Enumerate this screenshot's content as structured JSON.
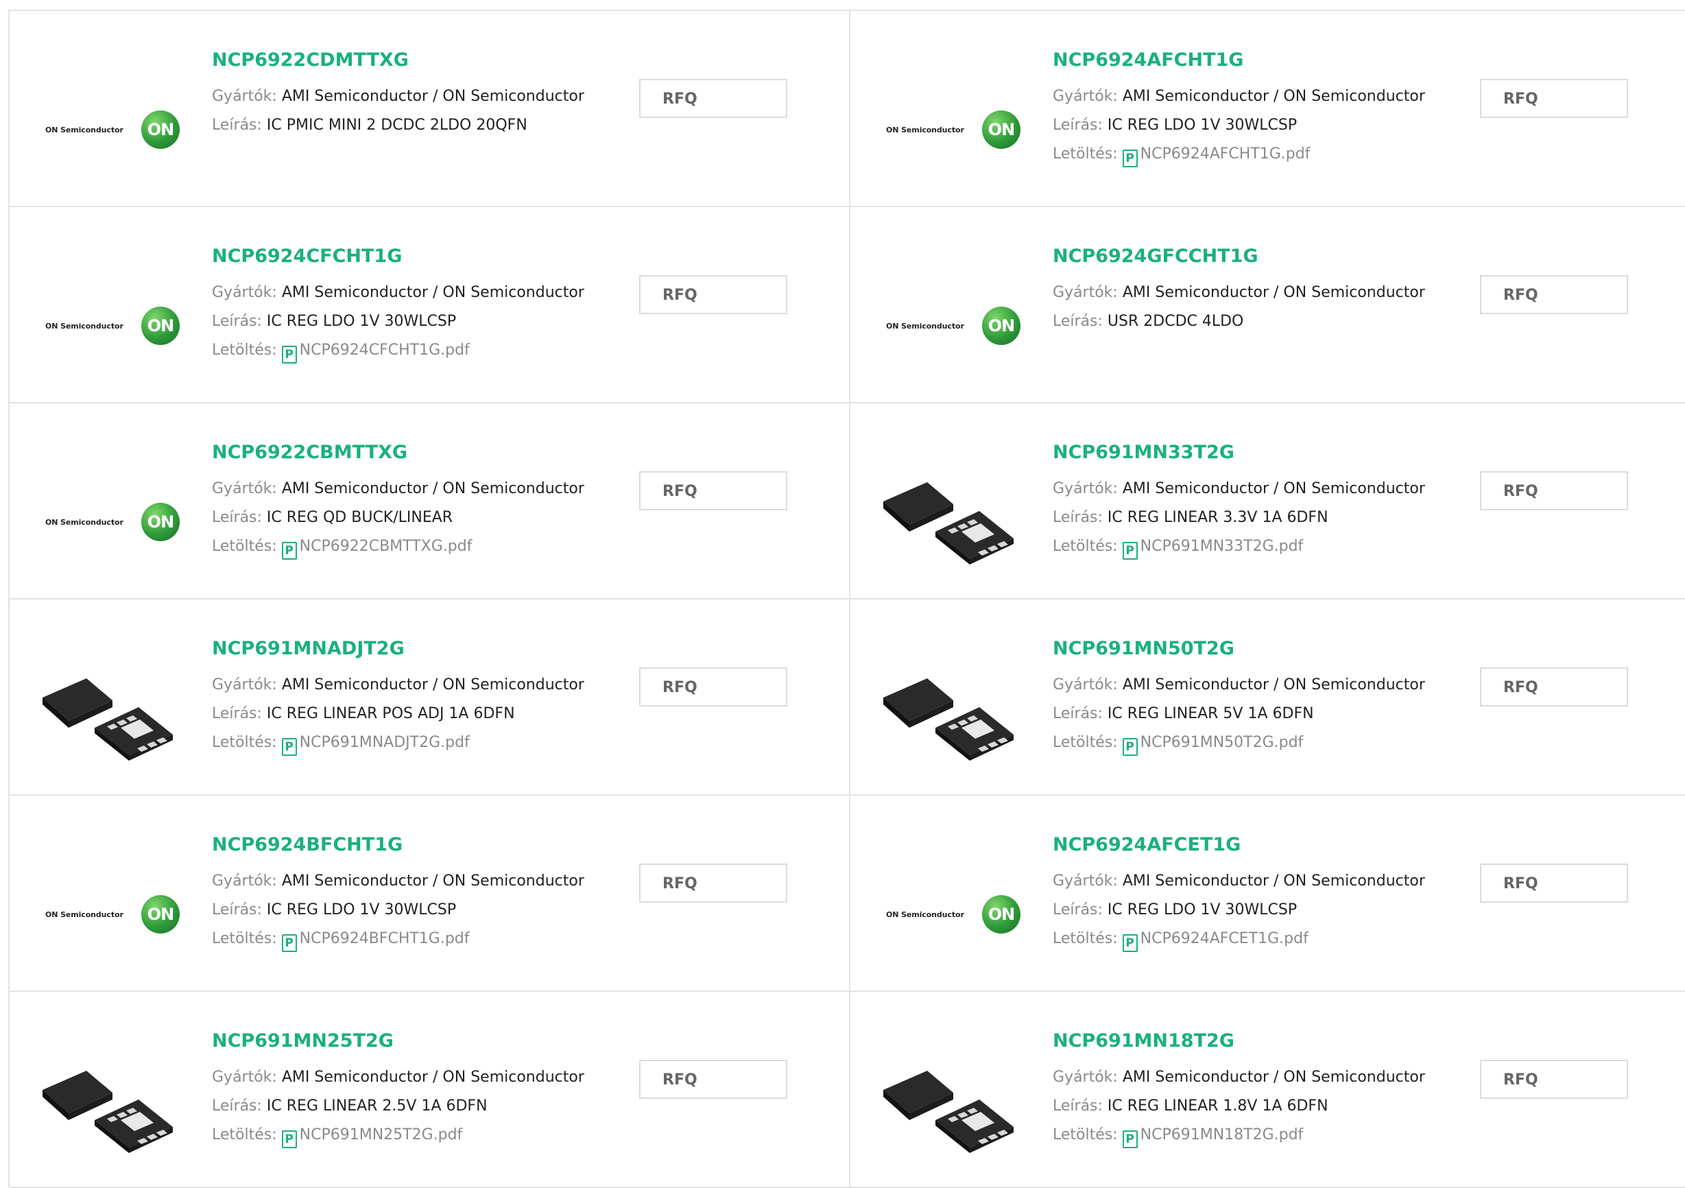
{
  "labels": {
    "manufacturer": "Gyártók:",
    "description": "Leírás:",
    "download": "Letöltés:",
    "rfq": "RFQ",
    "logo_text": "ON Semiconductor",
    "logo_mark": "ON",
    "pdf_glyph": "P"
  },
  "colors": {
    "accent": "#1ab07f",
    "label": "#8a8a8a",
    "border": "#e3e3e3"
  },
  "products": [
    {
      "pn": "NCP6922CDMTTXG",
      "maker": "AMI Semiconductor / ON Semiconductor",
      "desc": "IC PMIC MINI 2 DCDC 2LDO 20QFN",
      "pdf": "",
      "image": "on-logo"
    },
    {
      "pn": "NCP6924AFCHT1G",
      "maker": "AMI Semiconductor / ON Semiconductor",
      "desc": "IC REG LDO 1V 30WLCSP",
      "pdf": "NCP6924AFCHT1G.pdf",
      "image": "on-logo"
    },
    {
      "pn": "NCP6924CFCHT1G",
      "maker": "AMI Semiconductor / ON Semiconductor",
      "desc": "IC REG LDO 1V 30WLCSP",
      "pdf": "NCP6924CFCHT1G.pdf",
      "image": "on-logo"
    },
    {
      "pn": "NCP6924GFCCHT1G",
      "maker": "AMI Semiconductor / ON Semiconductor",
      "desc": "USR 2DCDC 4LDO",
      "pdf": "",
      "image": "on-logo"
    },
    {
      "pn": "NCP6922CBMTTXG",
      "maker": "AMI Semiconductor / ON Semiconductor",
      "desc": "IC REG QD BUCK/LINEAR",
      "pdf": "NCP6922CBMTTXG.pdf",
      "image": "on-logo"
    },
    {
      "pn": "NCP691MN33T2G",
      "maker": "AMI Semiconductor / ON Semiconductor",
      "desc": "IC REG LINEAR 3.3V 1A 6DFN",
      "pdf": "NCP691MN33T2G.pdf",
      "image": "dfn-chip"
    },
    {
      "pn": "NCP691MNADJT2G",
      "maker": "AMI Semiconductor / ON Semiconductor",
      "desc": "IC REG LINEAR POS ADJ 1A 6DFN",
      "pdf": "NCP691MNADJT2G.pdf",
      "image": "dfn-chip"
    },
    {
      "pn": "NCP691MN50T2G",
      "maker": "AMI Semiconductor / ON Semiconductor",
      "desc": "IC REG LINEAR 5V 1A 6DFN",
      "pdf": "NCP691MN50T2G.pdf",
      "image": "dfn-chip"
    },
    {
      "pn": "NCP6924BFCHT1G",
      "maker": "AMI Semiconductor / ON Semiconductor",
      "desc": "IC REG LDO 1V 30WLCSP",
      "pdf": "NCP6924BFCHT1G.pdf",
      "image": "on-logo"
    },
    {
      "pn": "NCP6924AFCET1G",
      "maker": "AMI Semiconductor / ON Semiconductor",
      "desc": "IC REG LDO 1V 30WLCSP",
      "pdf": "NCP6924AFCET1G.pdf",
      "image": "on-logo"
    },
    {
      "pn": "NCP691MN25T2G",
      "maker": "AMI Semiconductor / ON Semiconductor",
      "desc": "IC REG LINEAR 2.5V 1A 6DFN",
      "pdf": "NCP691MN25T2G.pdf",
      "image": "dfn-chip"
    },
    {
      "pn": "NCP691MN18T2G",
      "maker": "AMI Semiconductor / ON Semiconductor",
      "desc": "IC REG LINEAR 1.8V 1A 6DFN",
      "pdf": "NCP691MN18T2G.pdf",
      "image": "dfn-chip"
    }
  ]
}
